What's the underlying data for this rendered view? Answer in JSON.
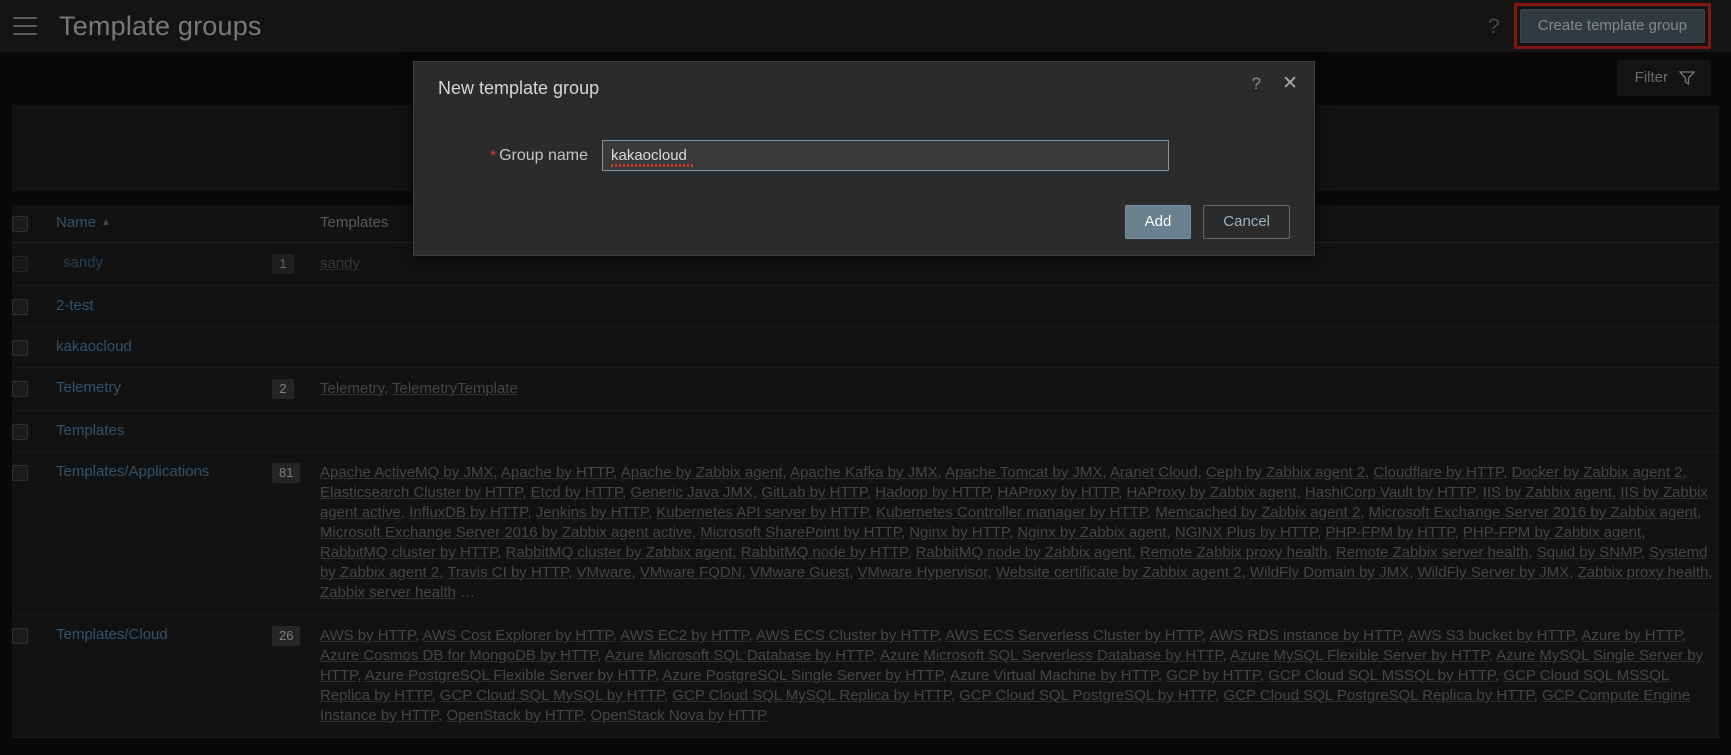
{
  "header": {
    "menu_icon": "hamburger-menu-icon",
    "title": "Template groups",
    "help_icon": "?",
    "create_button": "Create template group",
    "highlight_color": "#c62217"
  },
  "filter": {
    "label": "Filter",
    "icon": "funnel-icon"
  },
  "table": {
    "columns": {
      "name": "Name",
      "sort_arrow": "▲",
      "templates": "Templates"
    },
    "rows": [
      {
        "name": "sandy",
        "count": "1",
        "templates": [
          "sandy"
        ],
        "more": false
      },
      {
        "name": "2-test",
        "count": "",
        "templates": [],
        "more": false
      },
      {
        "name": "kakaocloud",
        "count": "",
        "templates": [],
        "more": false
      },
      {
        "name": "Telemetry",
        "count": "2",
        "templates": [
          "Telemetry",
          "TelemetryTemplate"
        ],
        "more": false
      },
      {
        "name": "Templates",
        "count": "",
        "templates": [],
        "more": false
      },
      {
        "name": "Templates/Applications",
        "count": "81",
        "templates": [
          "Apache ActiveMQ by JMX",
          "Apache by HTTP",
          "Apache by Zabbix agent",
          "Apache Kafka by JMX",
          "Apache Tomcat by JMX",
          "Aranet Cloud",
          "Ceph by Zabbix agent 2",
          "Cloudflare by HTTP",
          "Docker by Zabbix agent 2",
          "Elasticsearch Cluster by HTTP",
          "Etcd by HTTP",
          "Generic Java JMX",
          "GitLab by HTTP",
          "Hadoop by HTTP",
          "HAProxy by HTTP",
          "HAProxy by Zabbix agent",
          "HashiCorp Vault by HTTP",
          "IIS by Zabbix agent",
          "IIS by Zabbix agent active",
          "InfluxDB by HTTP",
          "Jenkins by HTTP",
          "Kubernetes API server by HTTP",
          "Kubernetes Controller manager by HTTP",
          "Memcached by Zabbix agent 2",
          "Microsoft Exchange Server 2016 by Zabbix agent",
          "Microsoft Exchange Server 2016 by Zabbix agent active",
          "Microsoft SharePoint by HTTP",
          "Nginx by HTTP",
          "Nginx by Zabbix agent",
          "NGINX Plus by HTTP",
          "PHP-FPM by HTTP",
          "PHP-FPM by Zabbix agent",
          "RabbitMQ cluster by HTTP",
          "RabbitMQ cluster by Zabbix agent",
          "RabbitMQ node by HTTP",
          "RabbitMQ node by Zabbix agent",
          "Remote Zabbix proxy health",
          "Remote Zabbix server health",
          "Squid by SNMP",
          "Systemd by Zabbix agent 2",
          "Travis CI by HTTP",
          "VMware",
          "VMware FQDN",
          "VMware Guest",
          "VMware Hypervisor",
          "Website certificate by Zabbix agent 2",
          "WildFly Domain by JMX",
          "WildFly Server by JMX",
          "Zabbix proxy health",
          "Zabbix server health"
        ],
        "more": true,
        "more_text": "…"
      },
      {
        "name": "Templates/Cloud",
        "count": "26",
        "templates": [
          "AWS by HTTP",
          "AWS Cost Explorer by HTTP",
          "AWS EC2 by HTTP",
          "AWS ECS Cluster by HTTP",
          "AWS ECS Serverless Cluster by HTTP",
          "AWS RDS instance by HTTP",
          "AWS S3 bucket by HTTP",
          "Azure by HTTP",
          "Azure Cosmos DB for MongoDB by HTTP",
          "Azure Microsoft SQL Database by HTTP",
          "Azure Microsoft SQL Serverless Database by HTTP",
          "Azure MySQL Flexible Server by HTTP",
          "Azure MySQL Single Server by HTTP",
          "Azure PostgreSQL Flexible Server by HTTP",
          "Azure PostgreSQL Single Server by HTTP",
          "Azure Virtual Machine by HTTP",
          "GCP by HTTP",
          "GCP Cloud SQL MSSQL by HTTP",
          "GCP Cloud SQL MSSQL Replica by HTTP",
          "GCP Cloud SQL MySQL by HTTP",
          "GCP Cloud SQL MySQL Replica by HTTP",
          "GCP Cloud SQL PostgreSQL by HTTP",
          "GCP Cloud SQL PostgreSQL Replica by HTTP",
          "GCP Compute Engine Instance by HTTP",
          "OpenStack by HTTP",
          "OpenStack Nova by HTTP"
        ],
        "more": false
      }
    ]
  },
  "dialog": {
    "title": "New template group",
    "help_icon": "?",
    "close_icon": "✕",
    "required_marker": "*",
    "group_name_label": "Group name",
    "group_name_value": "kakaocloud",
    "add_button": "Add",
    "cancel_button": "Cancel"
  }
}
